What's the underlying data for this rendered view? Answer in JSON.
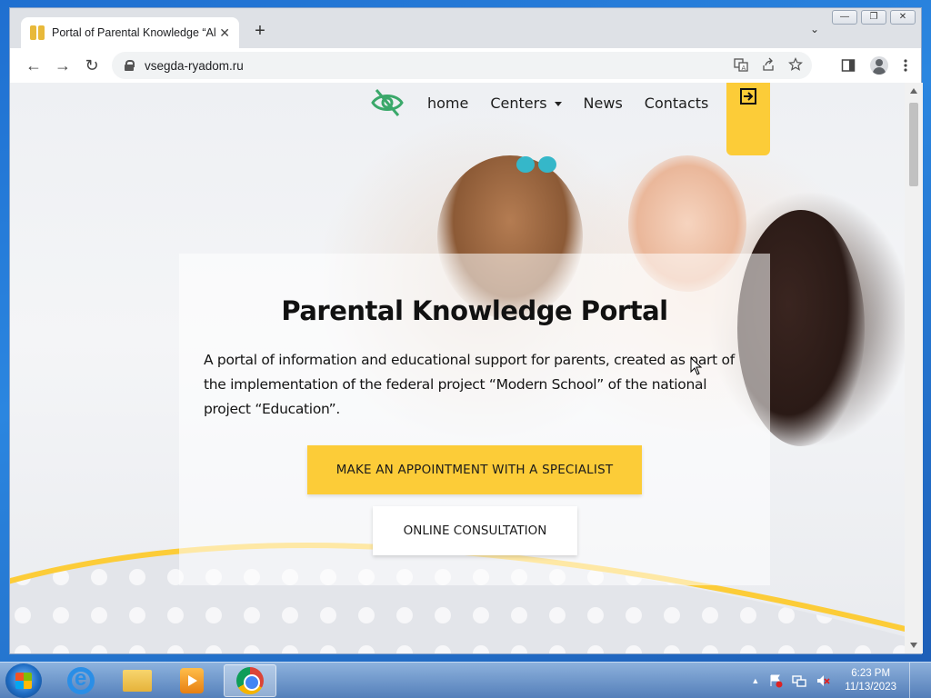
{
  "browser": {
    "tab_title": "Portal of Parental Knowledge “Al",
    "tab_close": "✕",
    "new_tab": "+",
    "tab_list": "⌄",
    "window_controls": {
      "minimize": "—",
      "restore": "❐",
      "close": "✕"
    },
    "url": "vsegda-ryadom.ru",
    "nav": {
      "back": "←",
      "forward": "→",
      "reload": "↻"
    },
    "icons": [
      "translate-icon",
      "share-icon",
      "star-icon",
      "sidepanel-icon",
      "profile-icon",
      "menu-icon"
    ]
  },
  "site": {
    "nav": [
      {
        "label": "home"
      },
      {
        "label": "Centers",
        "has_dropdown": true
      },
      {
        "label": "News"
      },
      {
        "label": "Contacts"
      }
    ],
    "accent_color": "#fccc38"
  },
  "hero": {
    "title": "Parental Knowledge Portal",
    "description": "A portal of information and educational support for parents, created as part of the implementation of the federal project “Modern School” of the national project “Education”.",
    "primary_button": "MAKE AN APPOINTMENT WITH A SPECIALIST",
    "secondary_button": "ONLINE CONSULTATION"
  },
  "taskbar": {
    "items": [
      "internet-explorer",
      "windows-explorer",
      "media-player",
      "google-chrome"
    ],
    "active": "google-chrome",
    "tray_arrow": "▲",
    "time": "6:23 PM",
    "date": "11/13/2023"
  }
}
